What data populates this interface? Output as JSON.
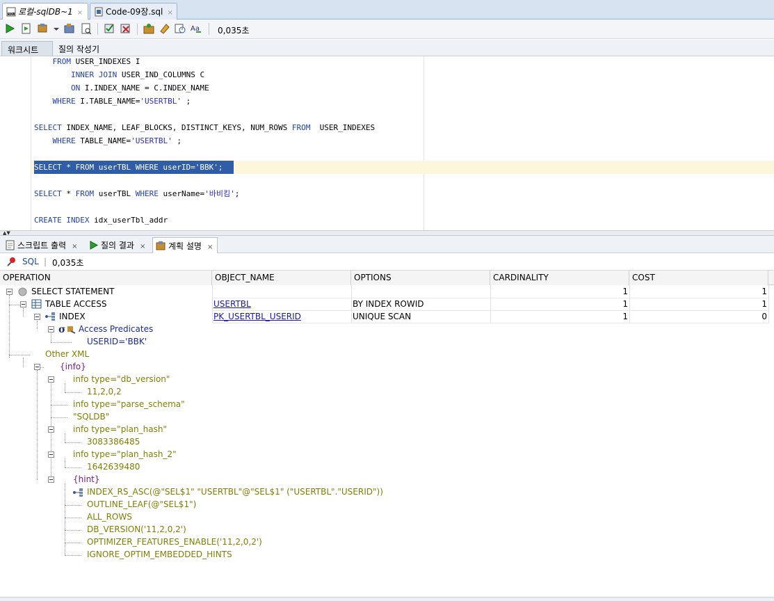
{
  "doc_tabs": [
    {
      "label": "로컬-sqlDB~1",
      "close": "×"
    },
    {
      "label": "Code-09장.sql",
      "close": "×"
    }
  ],
  "toolbar": {
    "elapsed": "0,035초"
  },
  "editor_tabs": {
    "worksheet": "워크시트",
    "query_builder": "질의 작성기"
  },
  "editor": {
    "lines": [
      "    FROM USER_INDEXES I",
      "        INNER JOIN USER_IND_COLUMNS C",
      "        ON I.INDEX_NAME = C.INDEX_NAME",
      "    WHERE I.TABLE_NAME='USERTBL' ;",
      "",
      "SELECT INDEX_NAME, LEAF_BLOCKS, DISTINCT_KEYS, NUM_ROWS FROM  USER_INDEXES",
      "    WHERE TABLE_NAME='USERTBL' ;",
      "",
      "SELECT * FROM userTBL WHERE userID='BBK';",
      "",
      "SELECT * FROM userTBL WHERE userName='바비킴';",
      "",
      "CREATE INDEX idx_userTbl_addr"
    ]
  },
  "panel_tabs": [
    {
      "label": "스크립트 출력",
      "close": "×"
    },
    {
      "label": "질의 결과",
      "close": "×"
    },
    {
      "label": "계획 설명",
      "close": "×"
    }
  ],
  "plan_info": {
    "sql": "SQL",
    "separator": "|",
    "elapsed": "0,035초"
  },
  "grid": {
    "columns": [
      "OPERATION",
      "OBJECT_NAME",
      "OPTIONS",
      "CARDINALITY",
      "COST"
    ],
    "rows": [
      {
        "operation": "SELECT STATEMENT",
        "object": "",
        "options": "",
        "cardinality": "1",
        "cost": "1"
      },
      {
        "operation": "TABLE ACCESS",
        "object": "USERTBL",
        "options": "BY INDEX ROWID",
        "cardinality": "1",
        "cost": "1"
      },
      {
        "operation": "INDEX",
        "object": "PK_USERTBL_USERID",
        "options": "UNIQUE SCAN",
        "cardinality": "1",
        "cost": "0"
      }
    ]
  },
  "tree": {
    "access_predicates": "Access Predicates",
    "predicate": "USERID='BBK'",
    "other_xml": "Other XML",
    "info_tag": "{info}",
    "db_version": "info type=\"db_version\"",
    "db_version_val": "11,2,0,2",
    "parse_schema": "info type=\"parse_schema\"",
    "parse_schema_val": "\"SQLDB\"",
    "plan_hash": "info type=\"plan_hash\"",
    "plan_hash_val": "3083386485",
    "plan_hash_2": "info type=\"plan_hash_2\"",
    "plan_hash_2_val": "1642639480",
    "hint_tag": "{hint}",
    "hints": [
      "INDEX_RS_ASC(@\"SEL$1\" \"USERTBL\"@\"SEL$1\" (\"USERTBL\".\"USERID\"))",
      "OUTLINE_LEAF(@\"SEL$1\")",
      "ALL_ROWS",
      "DB_VERSION('11,2,0,2')",
      "OPTIMIZER_FEATURES_ENABLE('11,2,0,2')",
      "IGNORE_OPTIM_EMBEDDED_HINTS"
    ]
  },
  "colors": {
    "keyword": "#1f3fb3",
    "string": "#2a2acb",
    "selection": "#2f5da8",
    "olive": "#808000",
    "purple": "#7a1a8a"
  }
}
